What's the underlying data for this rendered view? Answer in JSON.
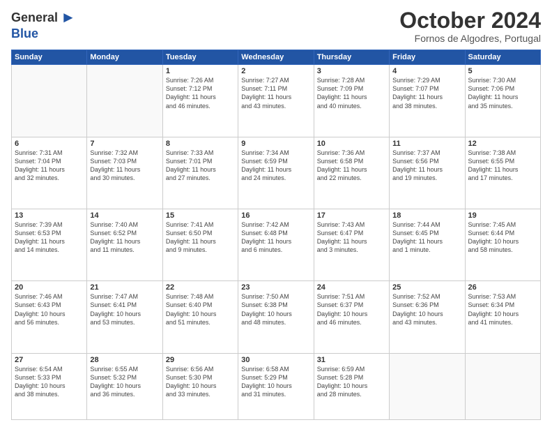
{
  "header": {
    "logo_general": "General",
    "logo_blue": "Blue",
    "month_title": "October 2024",
    "location": "Fornos de Algodres, Portugal"
  },
  "days_of_week": [
    "Sunday",
    "Monday",
    "Tuesday",
    "Wednesday",
    "Thursday",
    "Friday",
    "Saturday"
  ],
  "weeks": [
    [
      {
        "day": "",
        "info": ""
      },
      {
        "day": "",
        "info": ""
      },
      {
        "day": "1",
        "info": "Sunrise: 7:26 AM\nSunset: 7:12 PM\nDaylight: 11 hours\nand 46 minutes."
      },
      {
        "day": "2",
        "info": "Sunrise: 7:27 AM\nSunset: 7:11 PM\nDaylight: 11 hours\nand 43 minutes."
      },
      {
        "day": "3",
        "info": "Sunrise: 7:28 AM\nSunset: 7:09 PM\nDaylight: 11 hours\nand 40 minutes."
      },
      {
        "day": "4",
        "info": "Sunrise: 7:29 AM\nSunset: 7:07 PM\nDaylight: 11 hours\nand 38 minutes."
      },
      {
        "day": "5",
        "info": "Sunrise: 7:30 AM\nSunset: 7:06 PM\nDaylight: 11 hours\nand 35 minutes."
      }
    ],
    [
      {
        "day": "6",
        "info": "Sunrise: 7:31 AM\nSunset: 7:04 PM\nDaylight: 11 hours\nand 32 minutes."
      },
      {
        "day": "7",
        "info": "Sunrise: 7:32 AM\nSunset: 7:03 PM\nDaylight: 11 hours\nand 30 minutes."
      },
      {
        "day": "8",
        "info": "Sunrise: 7:33 AM\nSunset: 7:01 PM\nDaylight: 11 hours\nand 27 minutes."
      },
      {
        "day": "9",
        "info": "Sunrise: 7:34 AM\nSunset: 6:59 PM\nDaylight: 11 hours\nand 24 minutes."
      },
      {
        "day": "10",
        "info": "Sunrise: 7:36 AM\nSunset: 6:58 PM\nDaylight: 11 hours\nand 22 minutes."
      },
      {
        "day": "11",
        "info": "Sunrise: 7:37 AM\nSunset: 6:56 PM\nDaylight: 11 hours\nand 19 minutes."
      },
      {
        "day": "12",
        "info": "Sunrise: 7:38 AM\nSunset: 6:55 PM\nDaylight: 11 hours\nand 17 minutes."
      }
    ],
    [
      {
        "day": "13",
        "info": "Sunrise: 7:39 AM\nSunset: 6:53 PM\nDaylight: 11 hours\nand 14 minutes."
      },
      {
        "day": "14",
        "info": "Sunrise: 7:40 AM\nSunset: 6:52 PM\nDaylight: 11 hours\nand 11 minutes."
      },
      {
        "day": "15",
        "info": "Sunrise: 7:41 AM\nSunset: 6:50 PM\nDaylight: 11 hours\nand 9 minutes."
      },
      {
        "day": "16",
        "info": "Sunrise: 7:42 AM\nSunset: 6:48 PM\nDaylight: 11 hours\nand 6 minutes."
      },
      {
        "day": "17",
        "info": "Sunrise: 7:43 AM\nSunset: 6:47 PM\nDaylight: 11 hours\nand 3 minutes."
      },
      {
        "day": "18",
        "info": "Sunrise: 7:44 AM\nSunset: 6:45 PM\nDaylight: 11 hours\nand 1 minute."
      },
      {
        "day": "19",
        "info": "Sunrise: 7:45 AM\nSunset: 6:44 PM\nDaylight: 10 hours\nand 58 minutes."
      }
    ],
    [
      {
        "day": "20",
        "info": "Sunrise: 7:46 AM\nSunset: 6:43 PM\nDaylight: 10 hours\nand 56 minutes."
      },
      {
        "day": "21",
        "info": "Sunrise: 7:47 AM\nSunset: 6:41 PM\nDaylight: 10 hours\nand 53 minutes."
      },
      {
        "day": "22",
        "info": "Sunrise: 7:48 AM\nSunset: 6:40 PM\nDaylight: 10 hours\nand 51 minutes."
      },
      {
        "day": "23",
        "info": "Sunrise: 7:50 AM\nSunset: 6:38 PM\nDaylight: 10 hours\nand 48 minutes."
      },
      {
        "day": "24",
        "info": "Sunrise: 7:51 AM\nSunset: 6:37 PM\nDaylight: 10 hours\nand 46 minutes."
      },
      {
        "day": "25",
        "info": "Sunrise: 7:52 AM\nSunset: 6:36 PM\nDaylight: 10 hours\nand 43 minutes."
      },
      {
        "day": "26",
        "info": "Sunrise: 7:53 AM\nSunset: 6:34 PM\nDaylight: 10 hours\nand 41 minutes."
      }
    ],
    [
      {
        "day": "27",
        "info": "Sunrise: 6:54 AM\nSunset: 5:33 PM\nDaylight: 10 hours\nand 38 minutes."
      },
      {
        "day": "28",
        "info": "Sunrise: 6:55 AM\nSunset: 5:32 PM\nDaylight: 10 hours\nand 36 minutes."
      },
      {
        "day": "29",
        "info": "Sunrise: 6:56 AM\nSunset: 5:30 PM\nDaylight: 10 hours\nand 33 minutes."
      },
      {
        "day": "30",
        "info": "Sunrise: 6:58 AM\nSunset: 5:29 PM\nDaylight: 10 hours\nand 31 minutes."
      },
      {
        "day": "31",
        "info": "Sunrise: 6:59 AM\nSunset: 5:28 PM\nDaylight: 10 hours\nand 28 minutes."
      },
      {
        "day": "",
        "info": ""
      },
      {
        "day": "",
        "info": ""
      }
    ]
  ]
}
